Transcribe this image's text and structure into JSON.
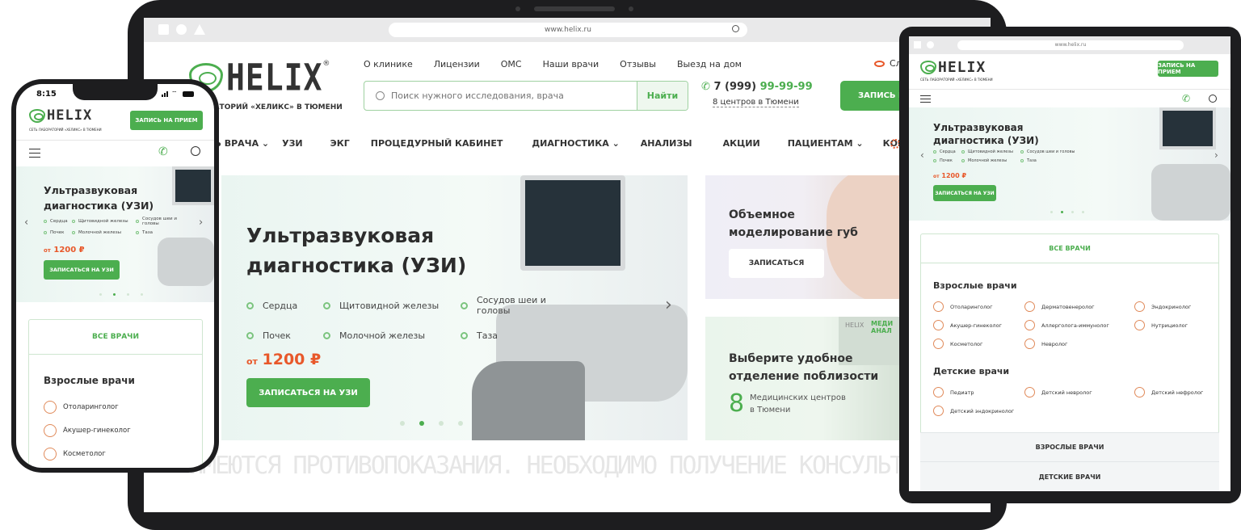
{
  "browser": {
    "url_desktop": "www.helix.ru",
    "url_tablet": "www.helix.ru"
  },
  "brand": {
    "name": "HELIX",
    "reg": "®",
    "tagline_desktop": "РАТОРИЙ «ХЕЛИКС» В ТЮМЕНИ",
    "tagline_small": "СЕТЬ ЛАБОРАТОРИЙ «ХЕЛИКС» В ТЮМЕНИ"
  },
  "top_links": [
    "О клинике",
    "Лицензии",
    "ОМС",
    "Наши врачи",
    "Отзывы",
    "Выезд на дом"
  ],
  "vision_link": "Сл",
  "search": {
    "placeholder": "Поиск нужного исследования, врача",
    "button": "Найти"
  },
  "phone": {
    "prefix": "7 (999)",
    "number": "99-99-99",
    "centers_link": "8 центров в Тюмени"
  },
  "appointment_btn": "ЗАПИСЬ НА",
  "appointment_btn_full": "ЗАПИСЬ НА ПРИЕМ",
  "nav": [
    {
      "label": "ТЬ ВРАЧА",
      "dropdown": true
    },
    {
      "label": "УЗИ",
      "dropdown": false
    },
    {
      "label": "ЭКГ",
      "dropdown": false
    },
    {
      "label": "ПРОЦЕДУРНЫЙ КАБИНЕТ",
      "dropdown": false
    },
    {
      "label": "ДИАГНОСТИКА",
      "dropdown": true
    },
    {
      "label": "АНАЛИЗЫ",
      "dropdown": false
    },
    {
      "label": "АКЦИИ",
      "dropdown": false
    },
    {
      "label": "ПАЦИЕНТАМ",
      "dropdown": true
    },
    {
      "label": "КОНТАКТЫ",
      "dropdown": false
    }
  ],
  "hero": {
    "title_line1": "Ультразвуковая",
    "title_line2": "диагностика (УЗИ)",
    "title_small_line1": "Ультразвуковая",
    "title_small_line2": "диагностика (УЗИ)",
    "items": [
      "Сердца",
      "Щитовидной железы",
      "Сосудов шеи и головы",
      "Почек",
      "Молочной железы",
      "Таза"
    ],
    "price_prefix": "от",
    "price": "1200 ₽",
    "cta": "ЗАПИСАТЬСЯ НА УЗИ",
    "slides": 4,
    "active_slide": 1
  },
  "promo1": {
    "title_line1": "Объемное",
    "title_line2": "моделирование губ",
    "cta": "ЗАПИСАТЬСЯ"
  },
  "promo2": {
    "title_line1": "Выберите удобное",
    "title_line2": "отделение поблизости",
    "count": "8",
    "count_text_line1": "Медицинских центров",
    "count_text_line2": "в Тюмени",
    "sign": "HELIX",
    "sign2": "МЕДИ\nАНАЛ"
  },
  "ticker": "ИМЕЮТСЯ ПРОТИВОПОКАЗАНИЯ. НЕОБХОДИМО ПОЛУЧЕНИЕ КОНСУЛЬТАЦИИ СПЕЦИА",
  "phone_status": {
    "time": "8:15"
  },
  "doctors": {
    "all_tab": "ВСЕ ВРАЧИ",
    "adult_title": "Взрослые врачи",
    "adult": [
      "Отоларинголог",
      "Дерматовенеролог",
      "Эндокринолог",
      "Акушер-гинеколог",
      "Аллерголога-иммунолог",
      "Нутрициолог",
      "Косметолог",
      "Невролог"
    ],
    "kids_title": "Детские врачи",
    "kids": [
      "Педиатр",
      "Детский невролог",
      "Детский нефролог",
      "Детский эндокринолог"
    ],
    "adult_tab": "ВЗРОСЛЫЕ ВРАЧИ",
    "kids_tab": "ДЕТСКИЕ ВРАЧИ"
  },
  "colors": {
    "accent": "#4cae4f",
    "price": "#e8582a",
    "frame": "#222222"
  }
}
